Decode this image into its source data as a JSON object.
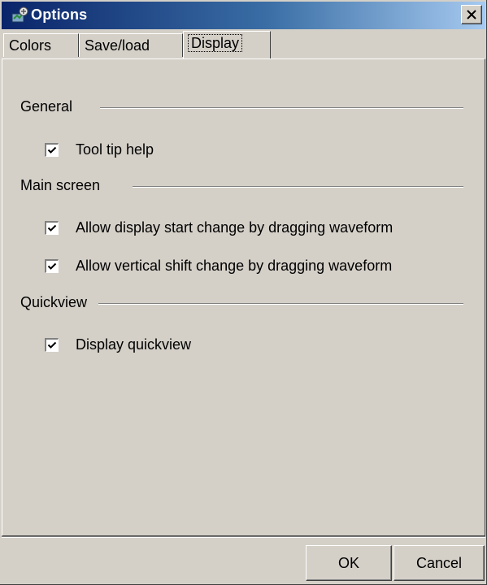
{
  "window": {
    "title": "Options"
  },
  "tabs": [
    {
      "label": "Colors",
      "active": false
    },
    {
      "label": "Save/load",
      "active": false
    },
    {
      "label": "Display",
      "active": true
    }
  ],
  "groups": {
    "general": {
      "title": "General",
      "options": [
        {
          "label": "Tool tip help",
          "checked": true
        }
      ]
    },
    "main_screen": {
      "title": "Main screen",
      "options": [
        {
          "label": "Allow display start change by dragging waveform",
          "checked": true
        },
        {
          "label": "Allow vertical shift change by dragging waveform",
          "checked": true
        }
      ]
    },
    "quickview": {
      "title": "Quickview",
      "options": [
        {
          "label": "Display quickview",
          "checked": true
        }
      ]
    }
  },
  "buttons": {
    "ok": "OK",
    "cancel": "Cancel"
  },
  "colors": {
    "face": "#d4d0c8",
    "title_start": "#0a246a",
    "title_end": "#a6caf0"
  }
}
